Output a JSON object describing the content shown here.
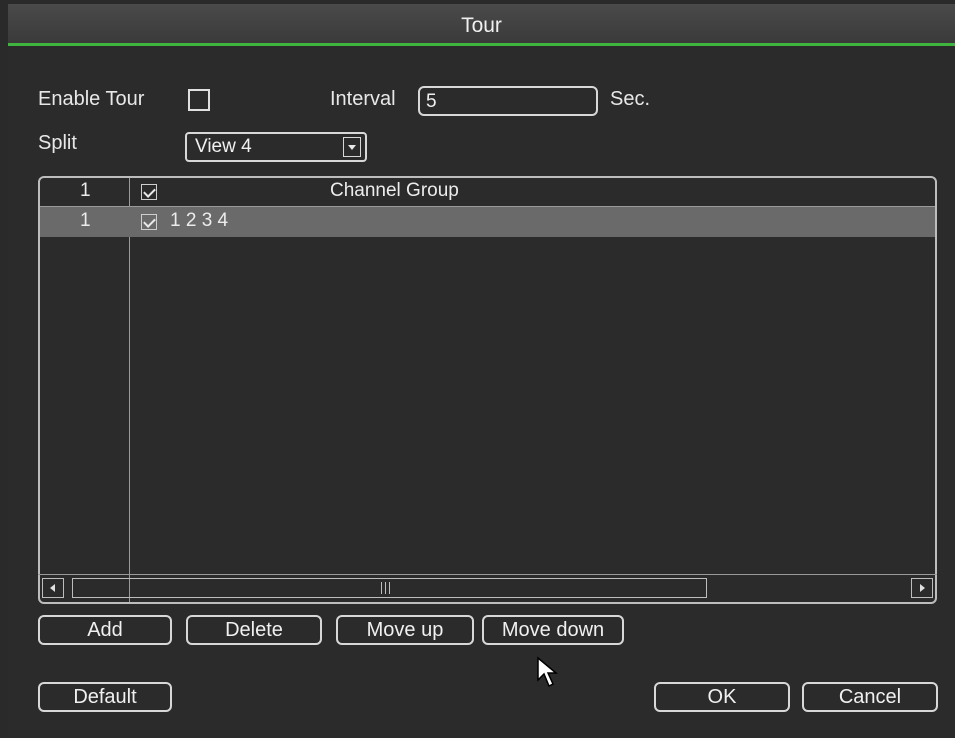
{
  "window": {
    "title": "Tour"
  },
  "form": {
    "enable_tour_label": "Enable Tour",
    "enable_tour_checked": false,
    "interval_label": "Interval",
    "interval_value": "5",
    "interval_unit": "Sec.",
    "split_label": "Split",
    "split_value": "View 4"
  },
  "table": {
    "header": {
      "index": "1",
      "checked": true,
      "title": "Channel Group"
    },
    "rows": [
      {
        "index": "1",
        "checked": true,
        "channels": "1  2  3  4",
        "selected": true
      }
    ]
  },
  "buttons": {
    "add": "Add",
    "delete": "Delete",
    "move_up": "Move up",
    "move_down": "Move down",
    "default": "Default",
    "ok": "OK",
    "cancel": "Cancel"
  },
  "colors": {
    "accent": "#3fb53f",
    "selected_row": "#6a6a6a",
    "background": "#2b2b2b"
  }
}
